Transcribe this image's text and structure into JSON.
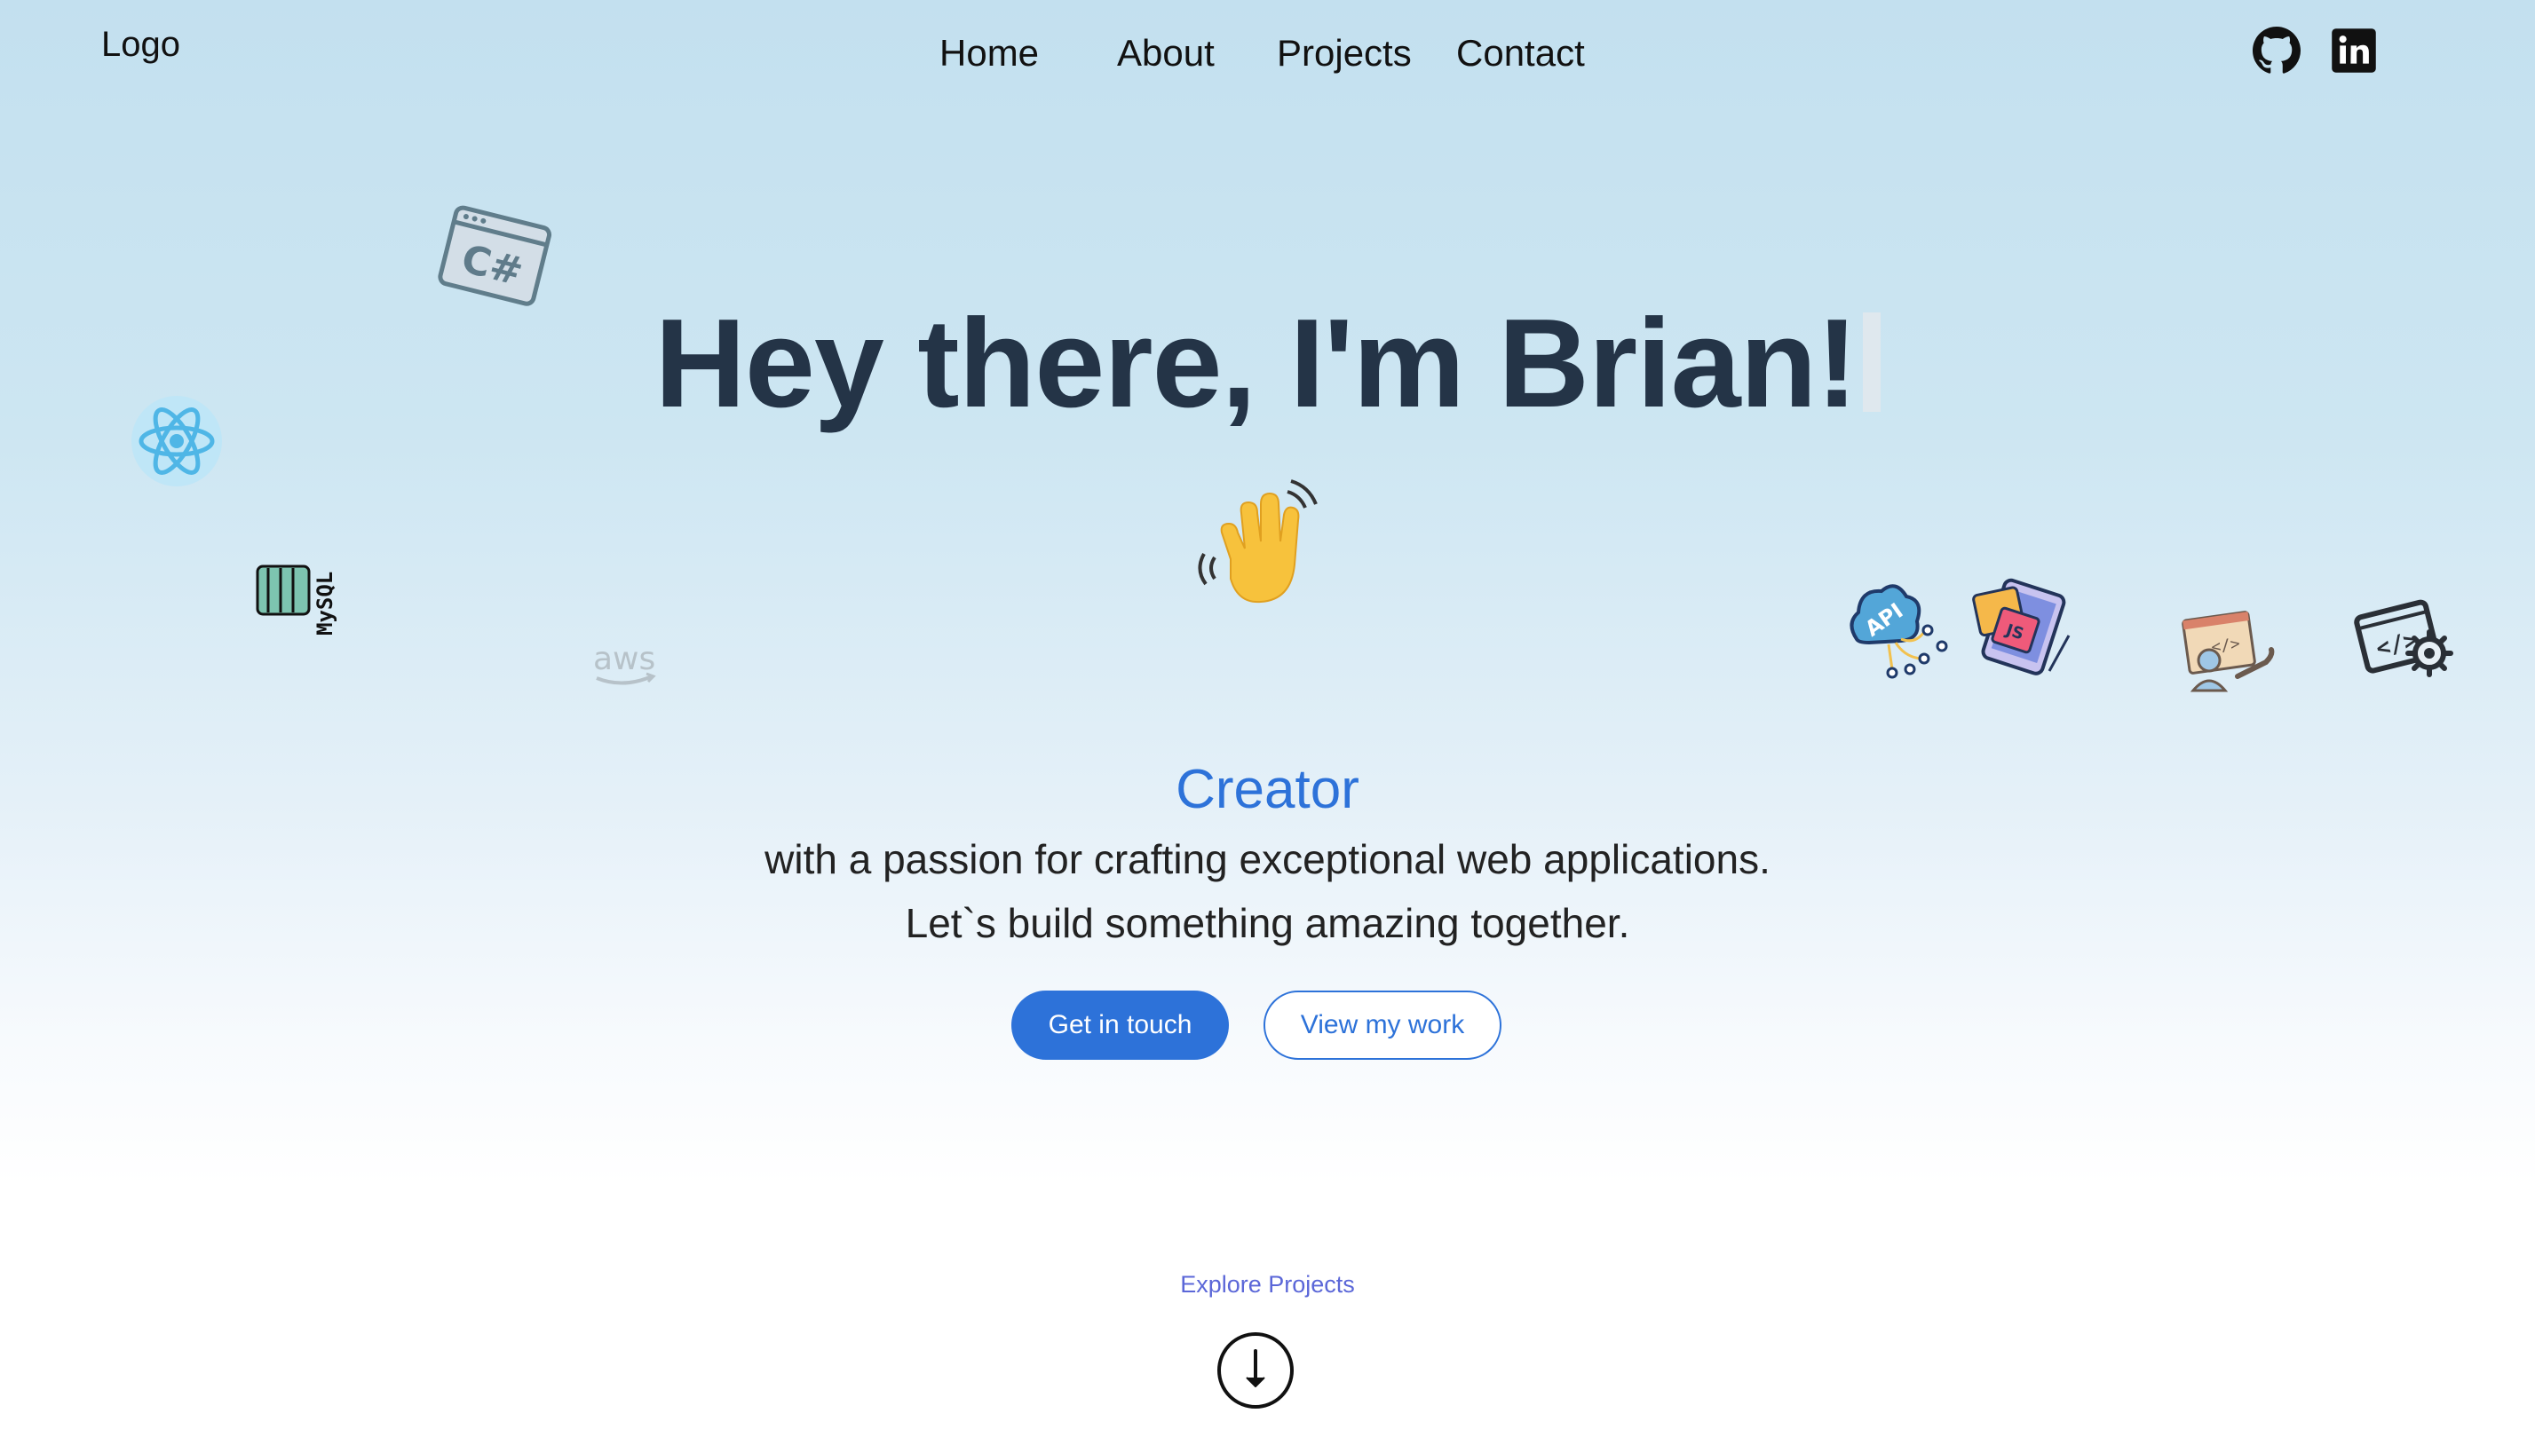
{
  "header": {
    "logo": "Logo",
    "nav": [
      {
        "label": "Home"
      },
      {
        "label": "About"
      },
      {
        "label": "Projects"
      },
      {
        "label": "Contact"
      }
    ],
    "social": [
      {
        "icon": "github-icon"
      },
      {
        "icon": "linkedin-icon"
      }
    ]
  },
  "hero": {
    "title": "Hey there, I'm Brian!",
    "role": "Creator",
    "tagline_line1": "with a passion for crafting exceptional web applications.",
    "tagline_line2": "Let`s build something amazing together.",
    "primary_button": "Get in touch",
    "secondary_button": "View my work"
  },
  "decorations": {
    "csharp_text": "C#",
    "mysql_text": "MySQL",
    "aws_text": "aws",
    "api_text": "API",
    "js_text": "JS"
  },
  "explore": {
    "label": "Explore Projects"
  },
  "colors": {
    "accent": "#2d72d9",
    "title": "#243447",
    "explore": "#5b67d8"
  }
}
